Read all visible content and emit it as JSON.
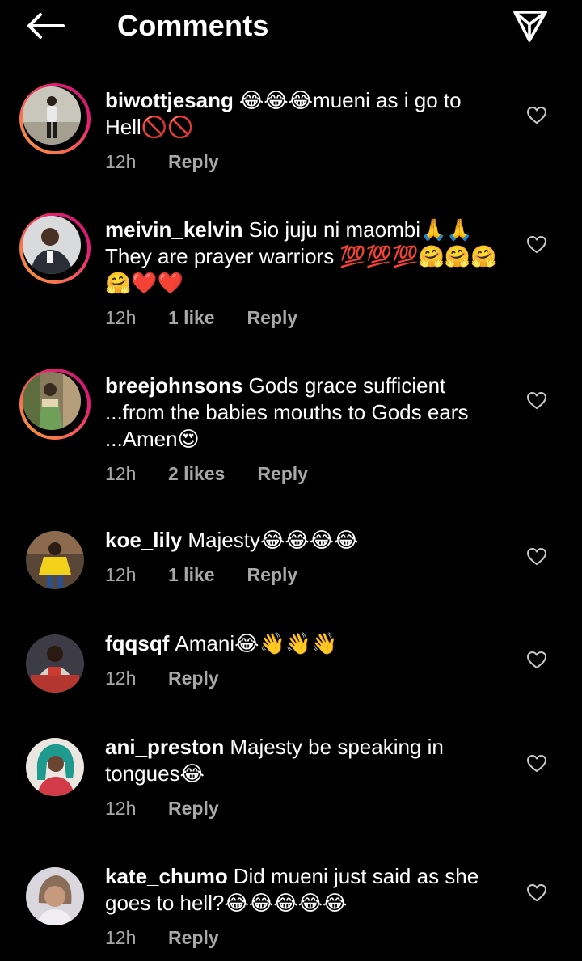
{
  "header": {
    "title": "Comments",
    "back_icon": "arrow-left-icon",
    "share_icon": "paper-plane-icon"
  },
  "colors": {
    "background": "#000000",
    "text": "#ffffff",
    "meta_text": "#a8a8a8",
    "story_ring_start": "#f7a13a",
    "story_ring_end": "#c2107a"
  },
  "comments": [
    {
      "username": "biwottjesang",
      "text": "😂😂😂mueni as i go to Hell🚫🚫",
      "time": "12h",
      "likes": "",
      "reply": "Reply",
      "has_story": true
    },
    {
      "username": "meivin_kelvin",
      "text": "Sio juju ni maombi🙏🙏 They are prayer warriors 💯💯💯🤗🤗🤗🤗❤️❤️",
      "time": "12h",
      "likes": "1 like",
      "reply": "Reply",
      "has_story": true
    },
    {
      "username": "breejohnsons",
      "text": "Gods grace sufficient ...from the babies mouths to Gods ears ...Amen😍",
      "time": "12h",
      "likes": "2 likes",
      "reply": "Reply",
      "has_story": true
    },
    {
      "username": "koe_lily",
      "text": "Majesty😂😂😂😂",
      "time": "12h",
      "likes": "1 like",
      "reply": "Reply",
      "has_story": false
    },
    {
      "username": "fqqsqf",
      "text": "Amani😂👋👋👋",
      "time": "12h",
      "likes": "",
      "reply": "Reply",
      "has_story": false
    },
    {
      "username": "ani_preston",
      "text": "Majesty be speaking in tongues😂",
      "time": "12h",
      "likes": "",
      "reply": "Reply",
      "has_story": false
    },
    {
      "username": "kate_chumo",
      "text": "Did mueni just said as she goes to hell?😂😂😂😂😂",
      "time": "12h",
      "likes": "",
      "reply": "Reply",
      "has_story": false
    }
  ]
}
